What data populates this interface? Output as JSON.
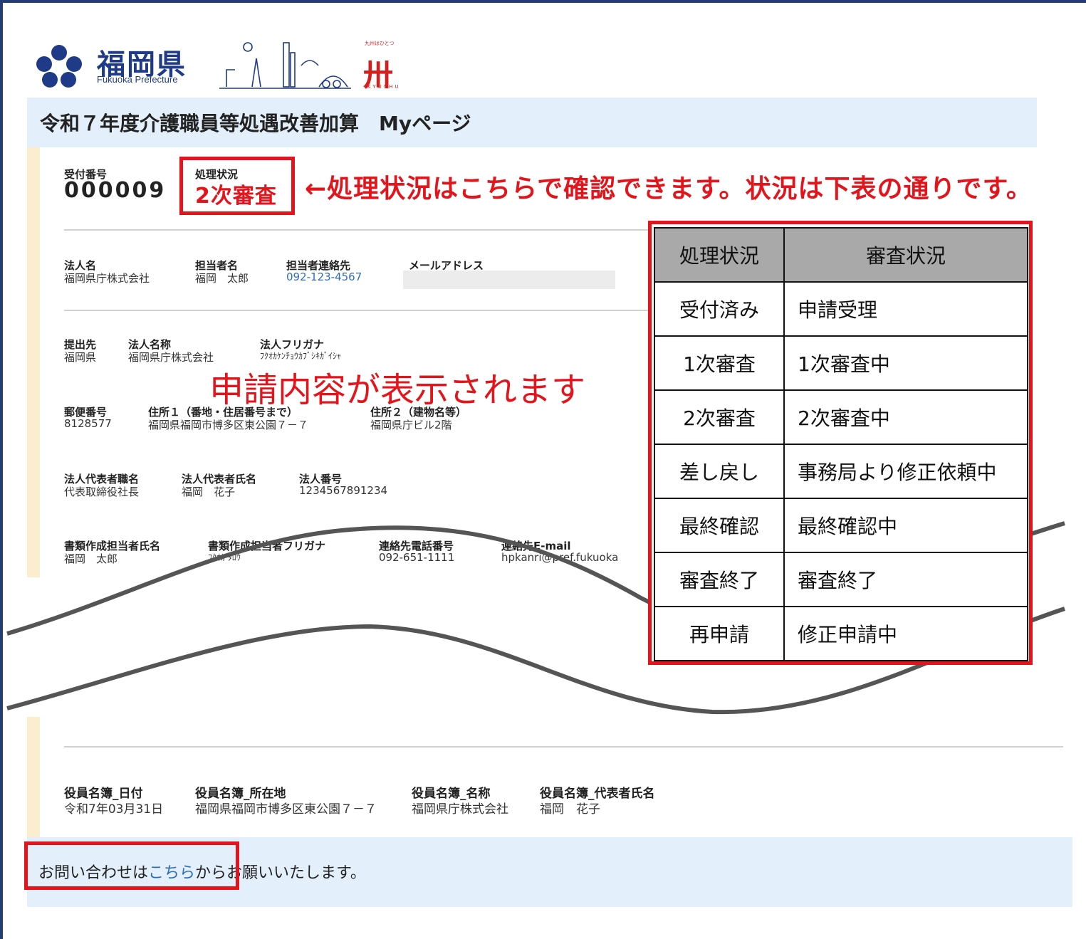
{
  "logo": {
    "prefecture_name": "福岡県",
    "prefecture_en": "Fukuoka Prefecture",
    "kyushu_top": "九州はひとつ",
    "kyushu_mark": "卅",
    "kyushu_en": "KYUSHU"
  },
  "header": {
    "title": "令和７年度介護職員等処遇改善加算　Myページ"
  },
  "reception": {
    "label": "受付番号",
    "value": "000009"
  },
  "status": {
    "label": "処理状況",
    "value": "2次審査"
  },
  "annotation": "←処理状況はこちらで確認できます。状況は下表の通りです。",
  "application_note": "申請内容が表示されます",
  "contact": {
    "corp_name_label": "法人名",
    "corp_name": "福岡県庁株式会社",
    "person_label": "担当者名",
    "person": "福岡　太郎",
    "phone_label": "担当者連絡先",
    "phone": "092-123-4567",
    "email_label": "メールアドレス"
  },
  "submission": {
    "dest_label": "提出先",
    "dest": "福岡県",
    "corp_label": "法人名称",
    "corp": "福岡県庁株式会社",
    "kana_label": "法人フリガナ",
    "kana": "ﾌｸｵｶｹﾝﾁｮｳｶﾌﾞｼｷｶﾞｲｼｬ"
  },
  "address": {
    "zip_label": "郵便番号",
    "zip": "8128577",
    "addr1_label": "住所１（番地・住居番号まで）",
    "addr1": "福岡県福岡市博多区東公園７－７",
    "addr2_label": "住所２（建物名等）",
    "addr2": "福岡県庁ビル2階"
  },
  "representative": {
    "title_label": "法人代表者職名",
    "title": "代表取締役社長",
    "name_label": "法人代表者氏名",
    "name": "福岡　花子",
    "number_label": "法人番号",
    "number": "1234567891234"
  },
  "doc_creator": {
    "name_label": "書類作成担当者氏名",
    "name": "福岡　太郎",
    "kana_label": "書類作成担当者フリガナ",
    "kana": "ﾌｸｵｶ ﾀﾛｳ",
    "phone_label": "連絡先電話番号",
    "phone": "092-651-1111",
    "email_label": "連絡先E-mail",
    "email": "hpkanri@pref.fukuoka"
  },
  "officers": {
    "date_label": "役員名簿_日付",
    "date": "令和7年03月31日",
    "location_label": "役員名簿_所在地",
    "location": "福岡県福岡市博多区東公園７－７",
    "name_label": "役員名簿_名称",
    "name": "福岡県庁株式会社",
    "rep_label": "役員名簿_代表者氏名",
    "rep": "福岡　花子"
  },
  "status_table": {
    "headers": [
      "処理状況",
      "審査状況"
    ],
    "rows": [
      [
        "受付済み",
        "申請受理"
      ],
      [
        "1次審査",
        "1次審査中"
      ],
      [
        "2次審査",
        "2次審査中"
      ],
      [
        "差し戻し",
        "事務局より修正依頼中"
      ],
      [
        "最終確認",
        "最終確認中"
      ],
      [
        "審査終了",
        "審査終了"
      ],
      [
        "再申請",
        "修正申請中"
      ]
    ]
  },
  "footer": {
    "before": "お問い合わせは",
    "link": "こちら",
    "after": "からお願いいたします。"
  },
  "colors": {
    "accent_red": "#e3151c",
    "brand_blue": "#1f3a86",
    "link_blue": "#2f6db5",
    "header_bg": "#e3f0fb"
  }
}
